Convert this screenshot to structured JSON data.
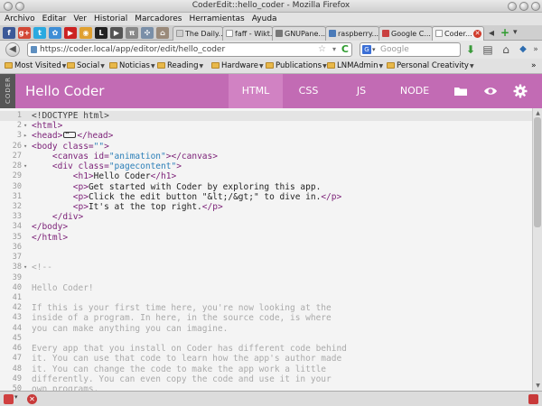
{
  "window": {
    "title": "CoderEdit::hello_coder - Mozilla Firefox"
  },
  "menu": [
    "Archivo",
    "Editar",
    "Ver",
    "Historial",
    "Marcadores",
    "Herramientas",
    "Ayuda"
  ],
  "pinned_tabs": [
    {
      "icon": "facebook-icon",
      "label": "f",
      "color": "#3b5998"
    },
    {
      "icon": "googleplus-icon",
      "label": "g+",
      "color": "#d34836"
    },
    {
      "icon": "twitter-icon",
      "label": "t",
      "color": "#2aa9e0"
    },
    {
      "icon": "pinwheel-icon",
      "label": "✿",
      "color": "#3f8ed6"
    },
    {
      "icon": "youtube-icon",
      "label": "▶",
      "color": "#cc2222"
    },
    {
      "icon": "photo-icon",
      "label": "◉",
      "color": "#e0a030"
    },
    {
      "icon": "lastpass-icon",
      "label": "L",
      "color": "#222222"
    },
    {
      "icon": "play-icon",
      "label": "▶",
      "color": "#555555"
    },
    {
      "icon": "pi-icon",
      "label": "π",
      "color": "#888888"
    },
    {
      "icon": "network-icon",
      "label": "✣",
      "color": "#7a8fa8"
    },
    {
      "icon": "home-icon",
      "label": "⌂",
      "color": "#9a8a7a"
    }
  ],
  "tabs": [
    {
      "label": "The Daily...",
      "favicon_color": "#cfcfcf"
    },
    {
      "label": "faff - Wikt...",
      "favicon_color": "#ffffff"
    },
    {
      "label": "GNUPane...",
      "favicon_color": "#777777"
    },
    {
      "label": "raspberry...",
      "favicon_color": "#4a7ab8"
    },
    {
      "label": "Google C...",
      "favicon_color": "#c94040"
    },
    {
      "label": "Coder...",
      "favicon_color": "#ffffff"
    }
  ],
  "tabbar": {
    "new_tab": "+",
    "list": "▾"
  },
  "nav": {
    "url": "https://coder.local/app/editor/edit/hello_coder",
    "search_placeholder": "Google",
    "search_engine": "G"
  },
  "bookmarks": [
    "Most Visited",
    "Social",
    "Noticias",
    "Reading",
    "Hardware",
    "Publications",
    "LNMAdmin",
    "Personal Creativity"
  ],
  "coder": {
    "logo_text": "CODER",
    "title": "Hello Coder",
    "tabs": [
      "HTML",
      "CSS",
      "JS",
      "NODE"
    ],
    "active_tab": "HTML",
    "accent": "#c26bb4",
    "active_tab_color": "#d182c3"
  },
  "code_lines": [
    {
      "num": "1",
      "fold": "",
      "segments": [
        [
          "t-doc",
          "<!DOCTYPE html>"
        ]
      ],
      "current": true
    },
    {
      "num": "2",
      "fold": "▾",
      "segments": [
        [
          "t-tag",
          "<html>"
        ]
      ]
    },
    {
      "num": "3",
      "fold": "▸",
      "segments": [
        [
          "t-tag",
          "<head>"
        ],
        [
          "fold-box",
          ""
        ],
        [
          "t-tag",
          "</head>"
        ]
      ]
    },
    {
      "num": "26",
      "fold": "▾",
      "segments": [
        [
          "t-tag",
          "<body "
        ],
        [
          "t-attr",
          "class="
        ],
        [
          "t-str",
          "\"\""
        ],
        [
          "t-tag",
          ">"
        ]
      ]
    },
    {
      "num": "27",
      "fold": "",
      "segments": [
        [
          "t-text",
          "    "
        ],
        [
          "t-tag",
          "<canvas "
        ],
        [
          "t-attr",
          "id="
        ],
        [
          "t-str",
          "\"animation\""
        ],
        [
          "t-tag",
          "></canvas>"
        ]
      ]
    },
    {
      "num": "28",
      "fold": "▾",
      "segments": [
        [
          "t-text",
          "    "
        ],
        [
          "t-tag",
          "<div "
        ],
        [
          "t-attr",
          "class="
        ],
        [
          "t-str",
          "\"pagecontent\""
        ],
        [
          "t-tag",
          ">"
        ]
      ]
    },
    {
      "num": "29",
      "fold": "",
      "segments": [
        [
          "t-text",
          "        "
        ],
        [
          "t-tag",
          "<h1>"
        ],
        [
          "t-text",
          "Hello Coder"
        ],
        [
          "t-tag",
          "</h1>"
        ]
      ]
    },
    {
      "num": "30",
      "fold": "",
      "segments": [
        [
          "t-text",
          "        "
        ],
        [
          "t-tag",
          "<p>"
        ],
        [
          "t-text",
          "Get started with Coder by exploring this app."
        ]
      ]
    },
    {
      "num": "31",
      "fold": "",
      "segments": [
        [
          "t-text",
          "        "
        ],
        [
          "t-tag",
          "<p>"
        ],
        [
          "t-text",
          "Click the edit button \"&lt;/&gt;\" to dive in."
        ],
        [
          "t-tag",
          "</p>"
        ]
      ]
    },
    {
      "num": "32",
      "fold": "",
      "segments": [
        [
          "t-text",
          "        "
        ],
        [
          "t-tag",
          "<p>"
        ],
        [
          "t-text",
          "It's at the top right."
        ],
        [
          "t-tag",
          "</p>"
        ]
      ]
    },
    {
      "num": "33",
      "fold": "",
      "segments": [
        [
          "t-text",
          "    "
        ],
        [
          "t-tag",
          "</div>"
        ]
      ]
    },
    {
      "num": "34",
      "fold": "",
      "segments": [
        [
          "t-tag",
          "</body>"
        ]
      ]
    },
    {
      "num": "35",
      "fold": "",
      "segments": [
        [
          "t-tag",
          "</html>"
        ]
      ]
    },
    {
      "num": "36",
      "fold": "",
      "segments": []
    },
    {
      "num": "37",
      "fold": "",
      "segments": []
    },
    {
      "num": "38",
      "fold": "▾",
      "segments": [
        [
          "t-com",
          "<!--"
        ]
      ]
    },
    {
      "num": "39",
      "fold": "",
      "segments": []
    },
    {
      "num": "40",
      "fold": "",
      "segments": [
        [
          "t-com",
          "Hello Coder!"
        ]
      ]
    },
    {
      "num": "41",
      "fold": "",
      "segments": []
    },
    {
      "num": "42",
      "fold": "",
      "segments": [
        [
          "t-com",
          "If this is your first time here, you're now looking at the"
        ]
      ]
    },
    {
      "num": "43",
      "fold": "",
      "segments": [
        [
          "t-com",
          "inside of a program. In here, in the source code, is where"
        ]
      ]
    },
    {
      "num": "44",
      "fold": "",
      "segments": [
        [
          "t-com",
          "you can make anything you can imagine."
        ]
      ]
    },
    {
      "num": "45",
      "fold": "",
      "segments": []
    },
    {
      "num": "46",
      "fold": "",
      "segments": [
        [
          "t-com",
          "Every app that you install on Coder has different code behind"
        ]
      ]
    },
    {
      "num": "47",
      "fold": "",
      "segments": [
        [
          "t-com",
          "it. You can use that code to learn how the app's author made"
        ]
      ]
    },
    {
      "num": "48",
      "fold": "",
      "segments": [
        [
          "t-com",
          "it. You can change the code to make the app work a little"
        ]
      ]
    },
    {
      "num": "49",
      "fold": "",
      "segments": [
        [
          "t-com",
          "differently. You can even copy the code and use it in your"
        ]
      ]
    },
    {
      "num": "50",
      "fold": "",
      "segments": [
        [
          "t-com",
          "own programs."
        ]
      ]
    }
  ]
}
